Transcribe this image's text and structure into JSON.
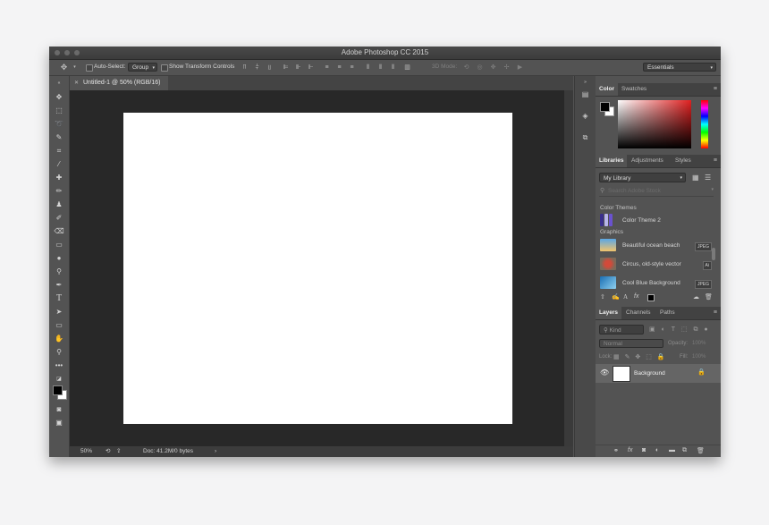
{
  "app": {
    "title": "Adobe Photoshop CC 2015"
  },
  "options_bar": {
    "auto_select_label": "Auto-Select:",
    "auto_select_target": "Group",
    "show_transform_label": "Show Transform Controls",
    "mode_3d_label": "3D Mode:",
    "workspace": "Essentials"
  },
  "document": {
    "tab_label": "Untitled-1 @ 50% (RGB/16)",
    "zoom": "50%",
    "doc_info": "Doc: 41.2M/0 bytes"
  },
  "color_panel": {
    "tabs": [
      "Color",
      "Swatches"
    ],
    "accent_color": "#e02020"
  },
  "libraries_panel": {
    "tabs": [
      "Libraries",
      "Adjustments",
      "Styles"
    ],
    "library_selected": "My Library",
    "search_placeholder": "Search Adobe Stock",
    "section_color_themes": "Color Themes",
    "color_theme_name": "Color Theme 2",
    "section_graphics": "Graphics",
    "graphics": [
      {
        "name": "Beautiful ocean beach",
        "badge": "JPEG"
      },
      {
        "name": "Circus, old-style vector",
        "badge": "Ai"
      },
      {
        "name": "Cool Blue Background",
        "badge": "JPEG"
      }
    ]
  },
  "layers_panel": {
    "tabs": [
      "Layers",
      "Channels",
      "Paths"
    ],
    "filter_kind": "Kind",
    "blend_mode": "Normal",
    "opacity_label": "Opacity:",
    "opacity_value": "100%",
    "lock_label": "Lock:",
    "fill_label": "Fill:",
    "fill_value": "100%",
    "layers": [
      {
        "name": "Background"
      }
    ]
  }
}
